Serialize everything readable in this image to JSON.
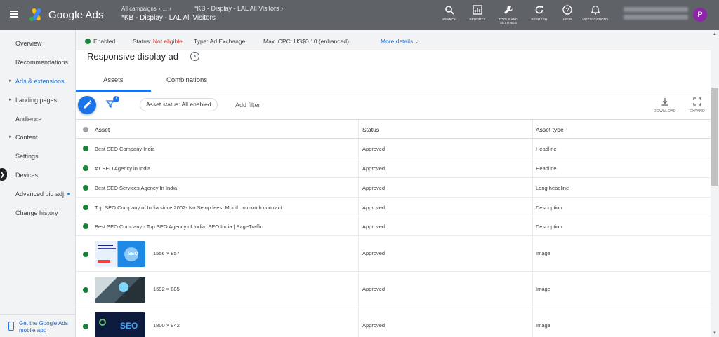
{
  "app": {
    "product_name": "Google Ads",
    "brand_colors": {
      "blue": "#4285f4",
      "yellow": "#fbbc04",
      "green": "#34a853"
    }
  },
  "breadcrumb": {
    "level1": "All campaigns",
    "level2": "...",
    "level3": "*KB - Display - LAL All Visitors",
    "current": "*KB - Display - LAL All Visitors"
  },
  "top_tools": [
    {
      "label": "SEARCH",
      "icon": "search-icon"
    },
    {
      "label": "REPORTS",
      "icon": "reports-icon"
    },
    {
      "label": "TOOLS AND SETTINGS",
      "icon": "wrench-icon"
    },
    {
      "label": "REFRESH",
      "icon": "refresh-icon"
    },
    {
      "label": "HELP",
      "icon": "help-icon"
    },
    {
      "label": "NOTIFICATIONS",
      "icon": "bell-icon"
    }
  ],
  "account": {
    "avatar_letter": "P",
    "avatar_color": "#8e24aa"
  },
  "sidebar": {
    "items": [
      {
        "label": "Overview"
      },
      {
        "label": "Recommendations"
      },
      {
        "label": "Ads & extensions"
      },
      {
        "label": "Landing pages"
      },
      {
        "label": "Audience"
      },
      {
        "label": "Content"
      },
      {
        "label": "Settings"
      },
      {
        "label": "Devices"
      },
      {
        "label": "Advanced bid adj."
      },
      {
        "label": "Change history"
      }
    ],
    "mobile_promo": "Get the Google Ads mobile app"
  },
  "status_bar": {
    "enabled": "Enabled",
    "status_label": "Status:",
    "status_value": "Not eligible",
    "type_label": "Type:",
    "type_value": "Ad Exchange",
    "cpc_label": "Max. CPC:",
    "cpc_value": "US$0.10 (enhanced)",
    "more_details": "More details"
  },
  "ad": {
    "title": "Responsive display ad",
    "tabs": [
      {
        "label": "Assets"
      },
      {
        "label": "Combinations"
      }
    ]
  },
  "toolbar": {
    "filter_count": "1",
    "chip_label": "Asset status: All enabled",
    "add_filter": "Add filter",
    "download": "DOWNLOAD",
    "expand": "EXPAND"
  },
  "table": {
    "headers": {
      "asset": "Asset",
      "status": "Status",
      "type": "Asset type",
      "sort_indicator": "↑"
    },
    "rows": [
      {
        "asset": "Best SEO Company India",
        "status": "Approved",
        "type": "Headline"
      },
      {
        "asset": "#1 SEO Agency in India",
        "status": "Approved",
        "type": "Headline"
      },
      {
        "asset": "Best SEO Services Agency In India",
        "status": "Approved",
        "type": "Long headline"
      },
      {
        "asset": "Top SEO Company of India since 2002- No Setup fees, Month to month contract",
        "status": "Approved",
        "type": "Description"
      },
      {
        "asset": "Best SEO Company - Top SEO Agency of India, SEO India | PageTraffic",
        "status": "Approved",
        "type": "Description"
      },
      {
        "asset": "1556 × 857",
        "status": "Approved",
        "type": "Image",
        "thumb_text": "SEO"
      },
      {
        "asset": "1692 × 885",
        "status": "Approved",
        "type": "Image"
      },
      {
        "asset": "1800 × 942",
        "status": "Approved",
        "type": "Image",
        "thumb_text": "SEO"
      }
    ]
  }
}
